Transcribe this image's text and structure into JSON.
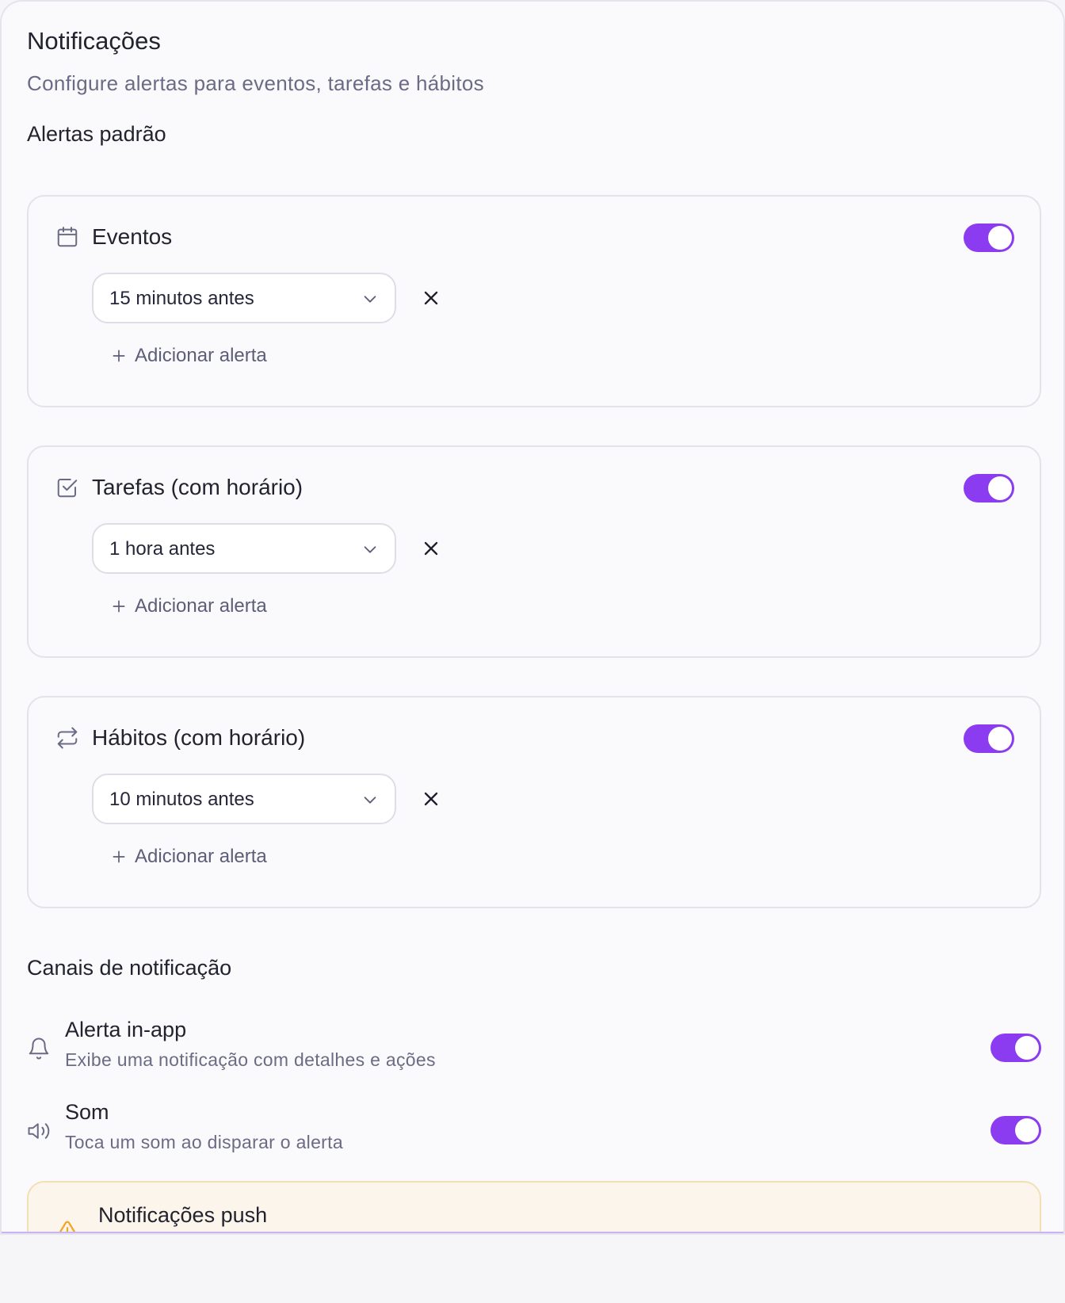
{
  "header": {
    "title": "Notificações",
    "subtitle": "Configure alertas para eventos, tarefas e hábitos"
  },
  "default_alerts": {
    "section_title": "Alertas padrão",
    "cards": [
      {
        "icon": "calendar-icon",
        "title": "Eventos",
        "enabled": true,
        "alert_value": "15 minutos antes",
        "add_label": "Adicionar alerta"
      },
      {
        "icon": "checkbox-icon",
        "title": "Tarefas (com horário)",
        "enabled": true,
        "alert_value": "1 hora antes",
        "add_label": "Adicionar alerta"
      },
      {
        "icon": "repeat-icon",
        "title": "Hábitos (com horário)",
        "enabled": true,
        "alert_value": "10 minutos antes",
        "add_label": "Adicionar alerta"
      }
    ]
  },
  "channels": {
    "section_title": "Canais de notificação",
    "items": [
      {
        "icon": "bell-icon",
        "title": "Alerta in-app",
        "description": "Exibe uma notificação com detalhes e ações",
        "enabled": true
      },
      {
        "icon": "speaker-icon",
        "title": "Som",
        "description": "Toca um som ao disparar o alerta",
        "enabled": true
      }
    ]
  },
  "push_notice": {
    "icon": "warning-icon",
    "title": "Notificações push"
  },
  "colors": {
    "accent": "#8b3cf0",
    "warning": "#f5a524",
    "warning_bg": "#fbf5ec"
  }
}
